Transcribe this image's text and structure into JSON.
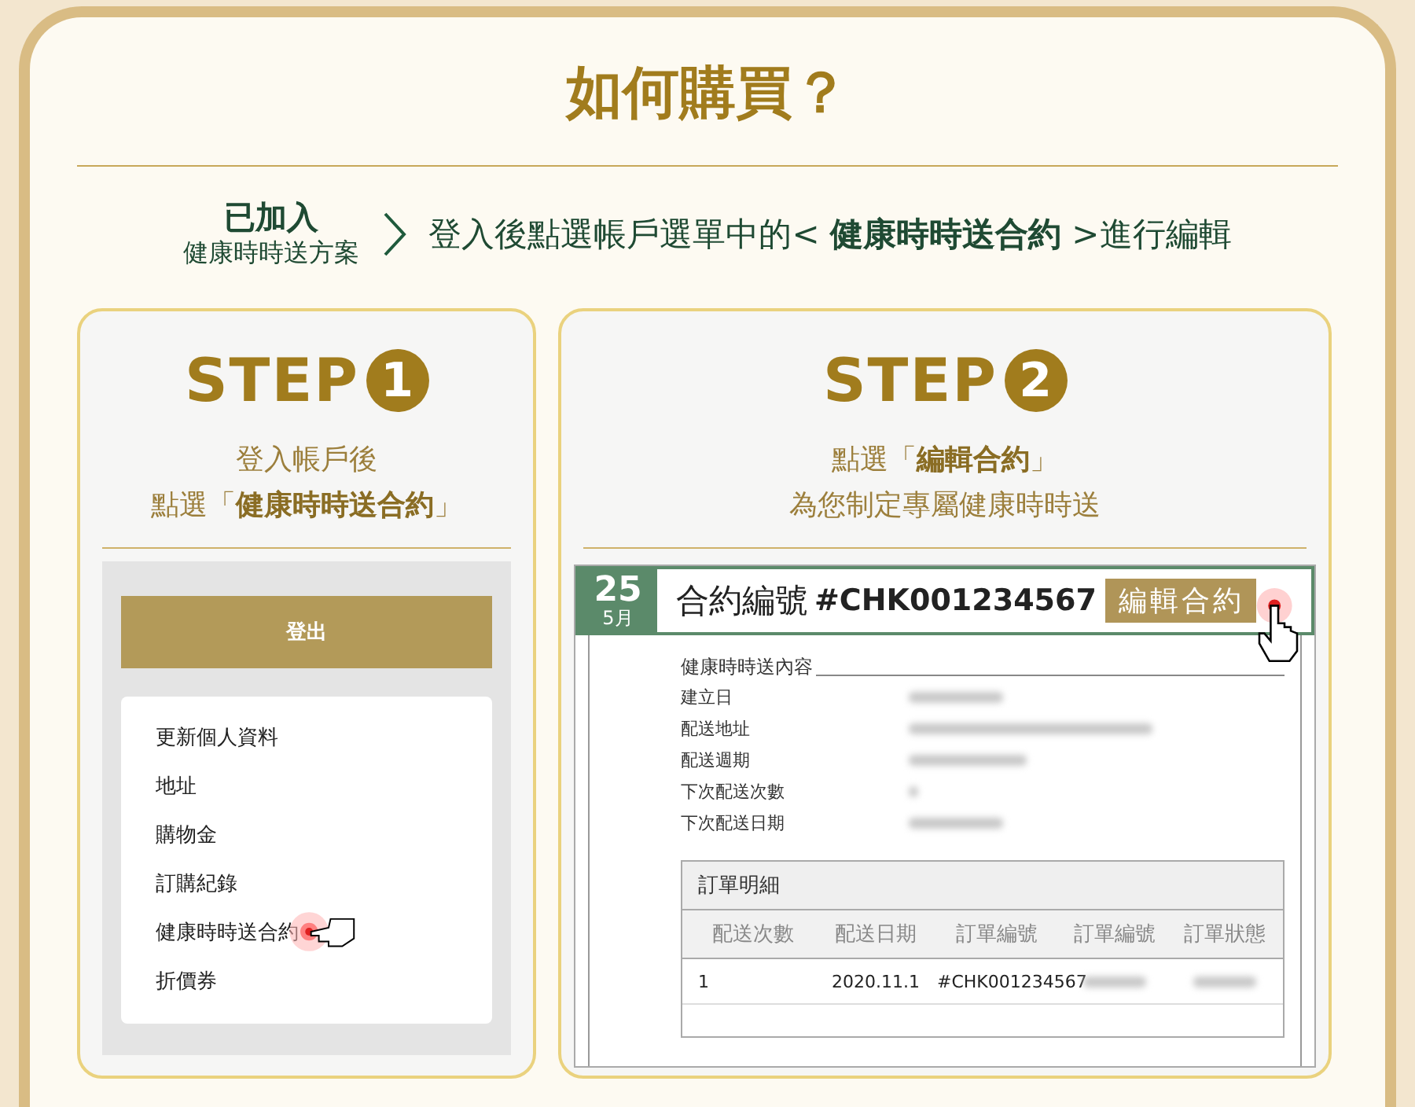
{
  "title": "如何購買？",
  "intro": {
    "badge_title": "已加入",
    "badge_subtitle": "健康時時送方案",
    "instruction": "登入後點選帳戶選單中的< **健康時時送合約** >進行編輯"
  },
  "steps": [
    {
      "kind": "menu",
      "label": "STEP",
      "number": "1",
      "caption": [
        "登入帳戶後",
        "點選「**健康時時送合約**」"
      ],
      "logout_button": "登出",
      "menu_items": [
        {
          "label": "更新個人資料",
          "selected": false
        },
        {
          "label": "地址",
          "selected": false
        },
        {
          "label": "購物金",
          "selected": false
        },
        {
          "label": "訂購紀錄",
          "selected": false
        },
        {
          "label": "健康時時送合約",
          "selected": true
        },
        {
          "label": "折價券",
          "selected": false
        }
      ]
    },
    {
      "kind": "contract",
      "label": "STEP",
      "number": "2",
      "caption": [
        "點選「**編輯合約**」",
        "為您制定專屬健康時時送"
      ],
      "day": "25",
      "month": "5月",
      "contract_label": "合約編號",
      "contract_number": "#CHK001234567",
      "edit_button": "編輯合約",
      "section_title": "健康時時送內容",
      "fields": [
        "建立日",
        "配送地址",
        "配送週期",
        "下次配送次數",
        "下次配送日期"
      ],
      "order_title": "訂單明細",
      "columns": [
        "配送次數",
        "配送日期",
        "訂單編號",
        "訂單編號",
        "訂單狀態"
      ],
      "rows": [
        [
          {
            "kind": "text",
            "text": "1"
          },
          {
            "kind": "text",
            "text": "2020.11.1"
          },
          {
            "kind": "text",
            "text": "#CHK001234567"
          },
          {
            "kind": "blurred"
          },
          {
            "kind": "blurred"
          }
        ]
      ]
    }
  ]
}
